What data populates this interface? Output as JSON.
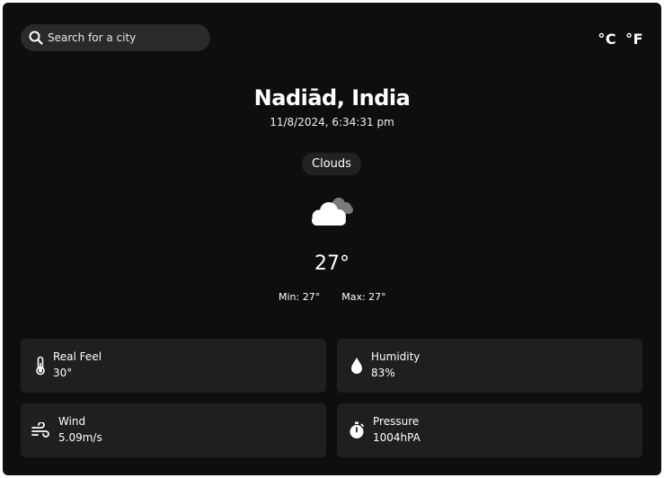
{
  "search": {
    "placeholder": "Search for a city"
  },
  "units": {
    "celsius": "°C",
    "fahrenheit": "°F"
  },
  "location": {
    "city": "Nadiād, India",
    "datetime": "11/8/2024, 6:34:31 pm"
  },
  "weather": {
    "condition": "Clouds",
    "icon": "cloud-icon",
    "temperature": "27°",
    "min": "Min: 27°",
    "max": "Max: 27°"
  },
  "details": {
    "real_feel": {
      "label": "Real Feel",
      "value": "30°",
      "icon": "thermometer-icon"
    },
    "humidity": {
      "label": "Humidity",
      "value": "83%",
      "icon": "droplet-icon"
    },
    "wind": {
      "label": "Wind",
      "value": "5.09m/s",
      "icon": "wind-icon"
    },
    "pressure": {
      "label": "Pressure",
      "value": "1004hPA",
      "icon": "stopwatch-icon"
    }
  },
  "colors": {
    "background": "#0e0e0e",
    "tile": "#1f1f1f",
    "search": "#2b2a29",
    "text": "#ffffff"
  }
}
